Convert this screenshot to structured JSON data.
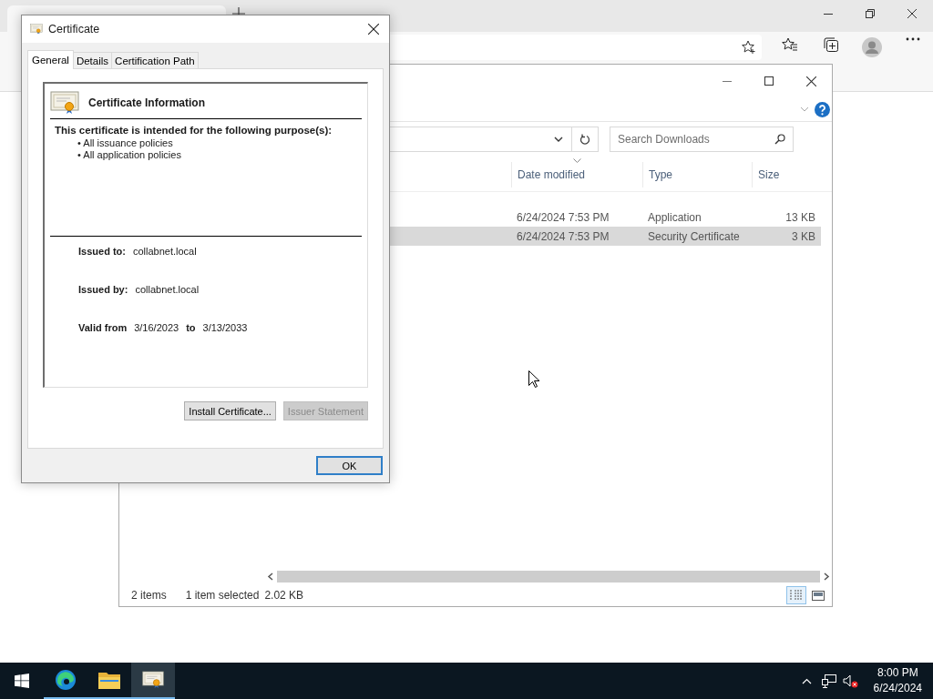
{
  "explorer": {
    "search": {
      "placeholder": "Search Downloads"
    },
    "columns": [
      "Date modified",
      "Type",
      "Size"
    ],
    "rows": [
      {
        "date_modified": "6/24/2024 7:53 PM",
        "type": "Application",
        "size": "13 KB",
        "selected": false
      },
      {
        "date_modified": "6/24/2024 7:53 PM",
        "type": "Security Certificate",
        "size": "3 KB",
        "selected": true
      }
    ],
    "status_bar": {
      "item_count": "2 items",
      "selection": "1 item selected",
      "selection_size": "2.02 KB"
    },
    "views": [
      {
        "kind": "details",
        "selected": true
      },
      {
        "kind": "preview",
        "selected": false
      }
    ]
  },
  "certificate_dialog": {
    "title": "Certificate",
    "tabs": [
      {
        "label": "General",
        "selected": true
      },
      {
        "label": "Details",
        "selected": false
      },
      {
        "label": "Certification Path",
        "selected": false
      }
    ],
    "heading": "Certificate Information",
    "purpose_heading": "This certificate is intended for the following purpose(s):",
    "purposes": [
      "• All issuance policies",
      "• All application policies"
    ],
    "issued_to": {
      "label": "Issued to:",
      "value": "collabnet.local"
    },
    "issued_by": {
      "label": "Issued by:",
      "value": "collabnet.local"
    },
    "validity": {
      "label": "Valid from",
      "from": "3/16/2023",
      "to_label": "to",
      "to": "3/13/2033"
    },
    "buttons": [
      {
        "label": "Install Certificate...",
        "disabled": false
      },
      {
        "label": "Issuer Statement",
        "disabled": true
      }
    ],
    "ok_button": "OK"
  },
  "taskbar": {
    "apps": [
      {
        "kind": "edge",
        "active": false
      },
      {
        "kind": "explorer",
        "active": false
      },
      {
        "kind": "certificate",
        "active": true
      }
    ],
    "clock": {
      "time": "8:00 PM",
      "date": "6/24/2024"
    }
  }
}
